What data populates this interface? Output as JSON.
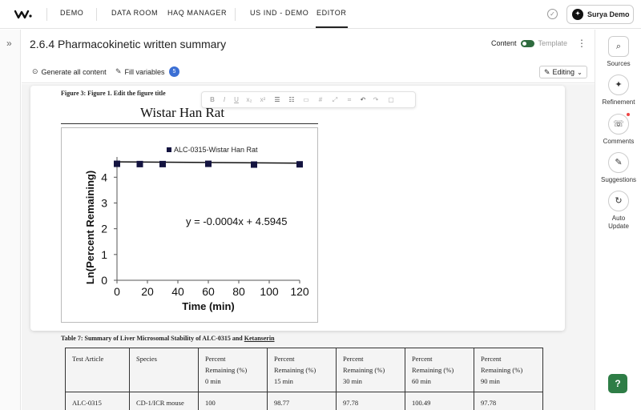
{
  "nav": {
    "items": [
      "DEMO",
      "DATA ROOM",
      "HAQ MANAGER",
      "US IND - DEMO",
      "EDITOR"
    ],
    "user": "Surya Demo"
  },
  "doc": {
    "title": "2.6.4 Pharmacokinetic written summary",
    "content_label": "Content",
    "template_label": "Template",
    "generate_label": "Generate all content",
    "fill_label": "Fill variables",
    "fill_count": "5",
    "mode_label": "Editing"
  },
  "rail": {
    "sources": "Sources",
    "refinement": "Refinement",
    "comments": "Comments",
    "suggestions": "Suggestions",
    "auto_update": "Auto\nUpdate"
  },
  "figure": {
    "caption": "Figure 3:  Figure 1. Edit the figure title",
    "title": "Wistar Han Rat"
  },
  "chart_data": {
    "type": "scatter",
    "title": "Wistar Han Rat",
    "xlabel": "Time (min)",
    "ylabel": "Ln(Percent Remaining)",
    "xlim": [
      0,
      120
    ],
    "ylim": [
      0,
      4.6
    ],
    "xticks": [
      0,
      20,
      40,
      60,
      80,
      100,
      120
    ],
    "yticks": [
      0,
      1,
      2,
      3,
      4
    ],
    "series": [
      {
        "name": "ALC-0315-Wistar Han Rat",
        "x": [
          0,
          15,
          30,
          60,
          90,
          120
        ],
        "y": [
          4.52,
          4.51,
          4.51,
          4.52,
          4.49,
          4.5
        ]
      }
    ],
    "trendline": {
      "slope": -0.0004,
      "intercept": 4.5945
    },
    "annotation": "y = -0.0004x + 4.5945",
    "legend": "top",
    "grid": false
  },
  "table": {
    "caption_prefix": "Table 7:  Summary of Liver Microsomal Stability of ALC-0315 and ",
    "caption_underlined": "Ketanserin",
    "headers": [
      [
        "Test Article"
      ],
      [
        "Species"
      ],
      [
        "Percent",
        "Remaining (%)",
        "0 min"
      ],
      [
        "Percent",
        "Remaining (%)",
        "15 min"
      ],
      [
        "Percent",
        "Remaining (%)",
        "30 min"
      ],
      [
        "Percent",
        "Remaining (%)",
        "60 min"
      ],
      [
        "Percent",
        "Remaining (%)",
        "90 min"
      ]
    ],
    "rows": [
      [
        "ALC-0315",
        "CD-1/ICR mouse",
        "100",
        "98.77",
        "97.78",
        "100.49",
        "97.78"
      ]
    ]
  },
  "colors": {
    "accent_green": "#2e6b3e",
    "badge_blue": "#3b6fd4",
    "marker": "#141440"
  }
}
